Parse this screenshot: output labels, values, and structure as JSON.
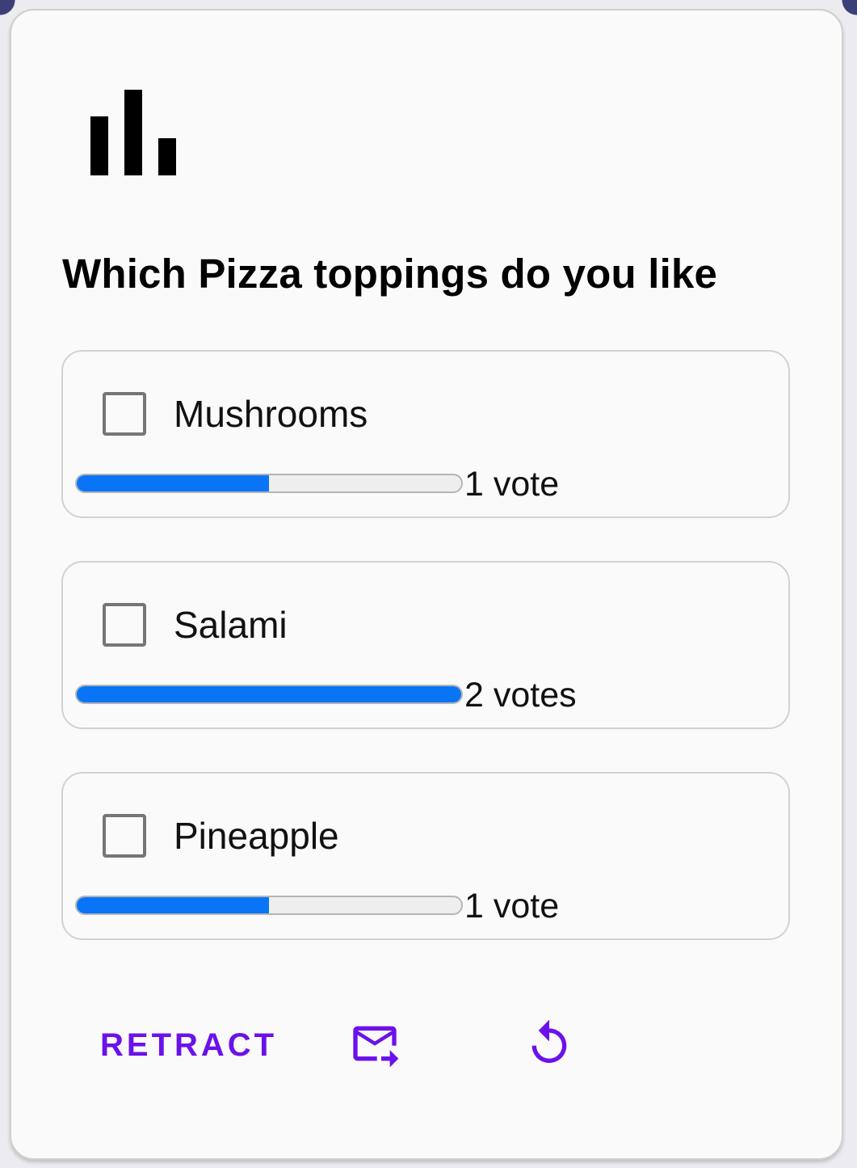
{
  "poll": {
    "question": "Which Pizza toppings do you like",
    "accent_color": "#6a12ea",
    "bar_color": "#0a74f7",
    "options": [
      {
        "label": "Mushrooms",
        "votes_text": "1 vote",
        "fraction": 0.5,
        "checked": false
      },
      {
        "label": "Salami",
        "votes_text": "2 votes",
        "fraction": 1.0,
        "checked": false
      },
      {
        "label": "Pineapple",
        "votes_text": "1 vote",
        "fraction": 0.5,
        "checked": false
      }
    ]
  },
  "actions": {
    "retract_label": "RETRACT",
    "icons": [
      "poll-icon",
      "forward-email-icon",
      "refresh-icon"
    ]
  }
}
